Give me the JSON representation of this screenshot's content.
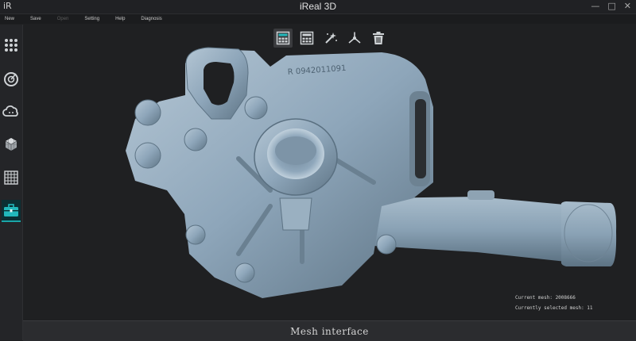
{
  "window": {
    "logo": "iR",
    "title": "iReal 3D",
    "controls": [
      "—",
      "□",
      "✕"
    ]
  },
  "menu": [
    {
      "label": "New",
      "enabled": true
    },
    {
      "label": "Save",
      "enabled": true
    },
    {
      "label": "Open",
      "enabled": false
    },
    {
      "label": "Setting",
      "enabled": true
    },
    {
      "label": "Help",
      "enabled": true
    },
    {
      "label": "Diagnosis",
      "enabled": true
    }
  ],
  "sidebar": {
    "items": [
      {
        "icon": "grid-dots-icon"
      },
      {
        "icon": "radar-target-icon"
      },
      {
        "icon": "cloud-icon"
      },
      {
        "icon": "cube-icon"
      },
      {
        "icon": "mesh-grid-icon"
      },
      {
        "icon": "toolbox-icon",
        "active": true
      }
    ],
    "subtools": [
      {
        "icon": "search-icon",
        "active": true
      },
      {
        "icon": "eye-icon"
      }
    ]
  },
  "toolbar": {
    "items": [
      {
        "icon": "calculator-icon",
        "active": true
      },
      {
        "icon": "calculator-grid-icon"
      },
      {
        "icon": "magic-wand-icon"
      },
      {
        "icon": "tri-axis-icon"
      },
      {
        "icon": "trash-icon"
      }
    ]
  },
  "mesh_label": "R 0942011091",
  "status": {
    "current_mesh": "Current mesh: 2008666",
    "selected_mesh": "Currently selected mesh: 11"
  },
  "bottom_label": "Mesh interface",
  "colors": {
    "accent": "#1aa6a8",
    "model": "#8ea6ba",
    "search_active": "#c0202a"
  }
}
